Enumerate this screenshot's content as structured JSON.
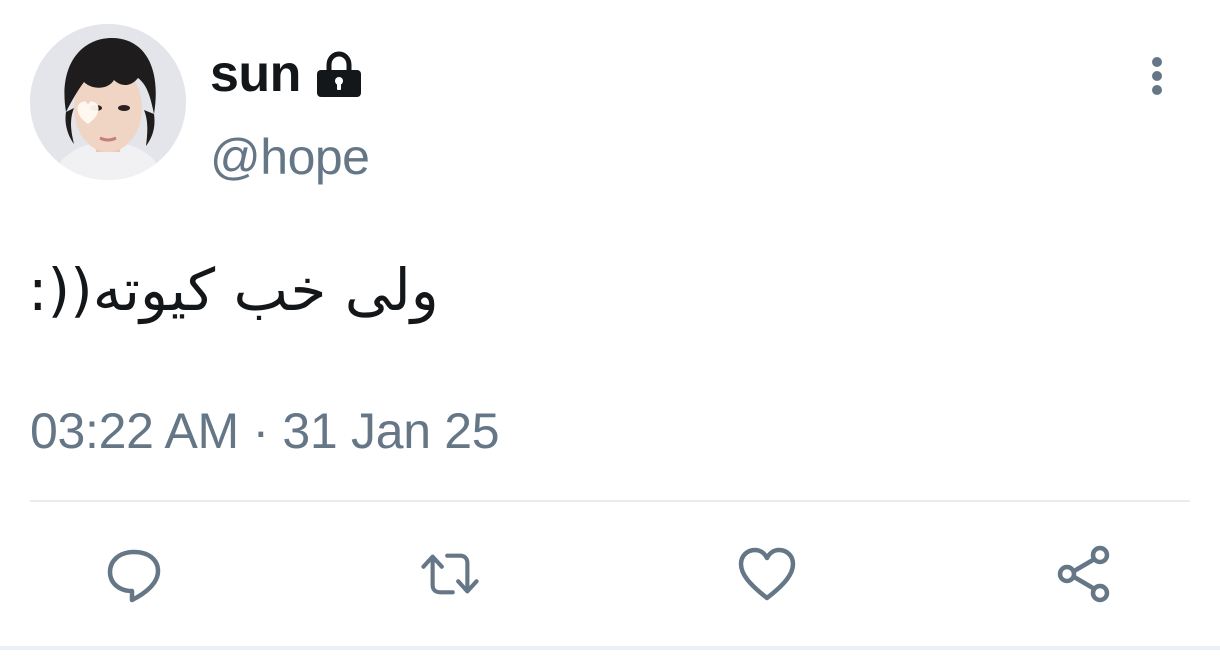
{
  "user": {
    "display_name": "sun",
    "handle": "@hope",
    "protected": true,
    "avatar_icon": "profile-photo"
  },
  "tweet": {
    "text": "ولی خب کیوته((:",
    "timestamp": "03:22 AM · 31 Jan 25"
  },
  "actions": {
    "reply_icon": "speech-bubble-icon",
    "retweet_icon": "retweet-arrows-icon",
    "like_icon": "heart-icon",
    "share_icon": "share-nodes-icon",
    "more_icon": "vertical-ellipsis-icon"
  },
  "colors": {
    "text_primary": "#14171a",
    "text_secondary": "#657786",
    "icon": "#657786",
    "divider": "#e6ecf0"
  }
}
